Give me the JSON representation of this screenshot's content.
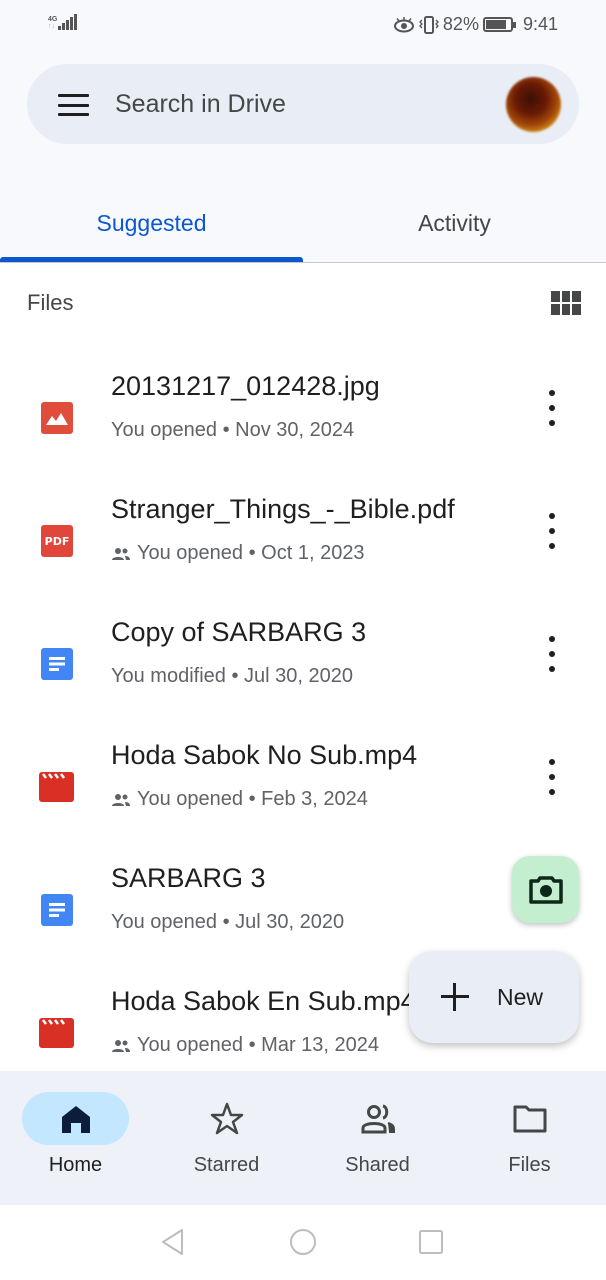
{
  "status_bar": {
    "network": "4G",
    "battery_percent": "82%",
    "battery_level": 0.82,
    "time": "9:41"
  },
  "search": {
    "placeholder": "Search in Drive"
  },
  "tabs": [
    {
      "label": "Suggested",
      "active": true
    },
    {
      "label": "Activity",
      "active": false
    }
  ],
  "files_section": {
    "title": "Files"
  },
  "files": [
    {
      "name": "20131217_012428.jpg",
      "type": "image",
      "shared": false,
      "meta": "You opened • Nov 30, 2024"
    },
    {
      "name": "Stranger_Things_-_Bible.pdf",
      "type": "pdf",
      "shared": true,
      "meta": "You opened • Oct 1, 2023"
    },
    {
      "name": "Copy of SARBARG 3",
      "type": "doc",
      "shared": false,
      "meta": "You modified • Jul 30, 2020"
    },
    {
      "name": "Hoda Sabok No Sub.mp4",
      "type": "video",
      "shared": true,
      "meta": "You opened • Feb 3, 2024"
    },
    {
      "name": "SARBARG 3",
      "type": "doc",
      "shared": false,
      "meta": "You opened • Jul 30, 2020"
    },
    {
      "name": "Hoda Sabok En Sub.mp4",
      "type": "video",
      "shared": true,
      "meta": "You opened • Mar 13, 2024"
    }
  ],
  "icon_labels": {
    "pdf": "PDF"
  },
  "fab": {
    "new_label": "New"
  },
  "bottom_nav": [
    {
      "label": "Home",
      "icon": "home-icon",
      "active": true
    },
    {
      "label": "Starred",
      "icon": "star-icon",
      "active": false
    },
    {
      "label": "Shared",
      "icon": "people-icon",
      "active": false
    },
    {
      "label": "Files",
      "icon": "folder-icon",
      "active": false
    }
  ],
  "colors": {
    "accent": "#0b57d0",
    "image_red": "#e04d3b",
    "pdf_red": "#e0463a",
    "doc_blue": "#4285f4",
    "video_red": "#d93025",
    "camera_fab": "#c4eed0",
    "nav_active_pill": "#c2e7ff"
  }
}
